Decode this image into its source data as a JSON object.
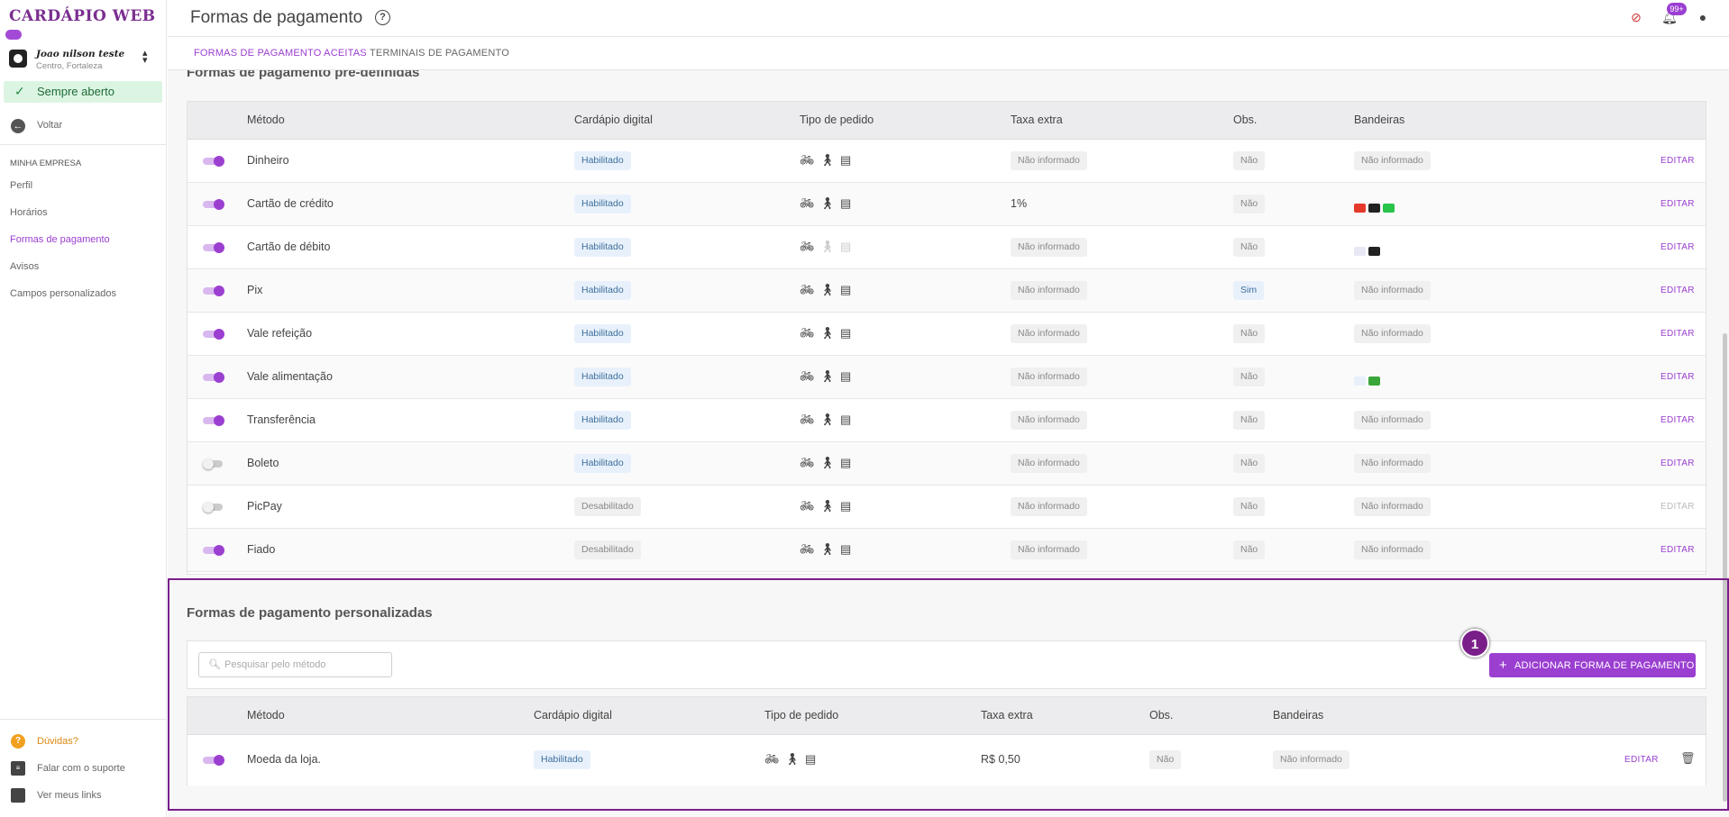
{
  "brand": {
    "logo_text": "CARDÁPIO WEB"
  },
  "store": {
    "name": "Joao nilson teste",
    "location": "Centro, Fortaleza"
  },
  "status": {
    "label": "Sempre aberto"
  },
  "sidebar": {
    "back_label": "Voltar",
    "section_title": "MINHA EMPRESA",
    "items": [
      {
        "label": "Perfil"
      },
      {
        "label": "Horários"
      },
      {
        "label": "Formas de pagamento"
      },
      {
        "label": "Avisos"
      },
      {
        "label": "Campos personalizados"
      }
    ],
    "footer": [
      {
        "label": "Dúvidas?"
      },
      {
        "label": "Falar com o suporte"
      },
      {
        "label": "Ver meus links"
      }
    ]
  },
  "header": {
    "title": "Formas de pagamento",
    "help_glyph": "?",
    "notification_count": "99+"
  },
  "tabs": [
    {
      "label": "FORMAS DE PAGAMENTO ACEITAS"
    },
    {
      "label": "TERMINAIS DE PAGAMENTO"
    }
  ],
  "predefined": {
    "title": "Formas de pagamento pré-definidas",
    "columns": [
      "Método",
      "Cardápio digital",
      "Tipo de pedido",
      "Taxa extra",
      "Obs.",
      "Bandeiras"
    ],
    "edit_label": "EDITAR",
    "rows": [
      {
        "enabled": true,
        "method": "Dinheiro",
        "digital": "Habilitado",
        "fee": "Não informado",
        "obs": "Não",
        "flags": "Não informado"
      },
      {
        "enabled": true,
        "method": "Cartão de crédito",
        "digital": "Habilitado",
        "fee": "1%",
        "obs": "Não",
        "flags": ""
      },
      {
        "enabled": true,
        "method": "Cartão de débito",
        "digital": "Habilitado",
        "fee": "Não informado",
        "obs": "Não",
        "flags": ""
      },
      {
        "enabled": true,
        "method": "Pix",
        "digital": "Habilitado",
        "fee": "Não informado",
        "obs": "Sim",
        "flags": "Não informado"
      },
      {
        "enabled": true,
        "method": "Vale refeição",
        "digital": "Habilitado",
        "fee": "Não informado",
        "obs": "Não",
        "flags": "Não informado"
      },
      {
        "enabled": true,
        "method": "Vale alimentação",
        "digital": "Habilitado",
        "fee": "Não informado",
        "obs": "Não",
        "flags": ""
      },
      {
        "enabled": true,
        "method": "Transferência",
        "digital": "Habilitado",
        "fee": "Não informado",
        "obs": "Não",
        "flags": "Não informado"
      },
      {
        "enabled": false,
        "method": "Boleto",
        "digital": "Habilitado",
        "fee": "Não informado",
        "obs": "Não",
        "flags": "Não informado"
      },
      {
        "enabled": false,
        "method": "PicPay",
        "digital": "Desabilitado",
        "fee": "Não informado",
        "obs": "Não",
        "flags": "Não informado"
      },
      {
        "enabled": true,
        "method": "Fiado",
        "digital": "Desabilitado",
        "fee": "Não informado",
        "obs": "Não",
        "flags": "Não informado"
      }
    ]
  },
  "custom": {
    "title": "Formas de pagamento personalizadas",
    "search_placeholder": "Pesquisar pelo método",
    "add_button_label": "ADICIONAR FORMA DE PAGAMENTO",
    "step_number": "1",
    "columns": [
      "Método",
      "Cardápio digital",
      "Tipo de pedido",
      "Taxa extra",
      "Obs.",
      "Bandeiras"
    ],
    "edit_label": "EDITAR",
    "rows": [
      {
        "enabled": true,
        "method": "Moeda da loja.",
        "digital": "Habilitado",
        "fee": "R$ 0,50",
        "obs": "Não",
        "flags": "Não informado"
      }
    ]
  },
  "colors": {
    "accent": "#9b3fd1",
    "highlight_border": "#7a1f8a",
    "open_bg": "#dcf5e3"
  }
}
